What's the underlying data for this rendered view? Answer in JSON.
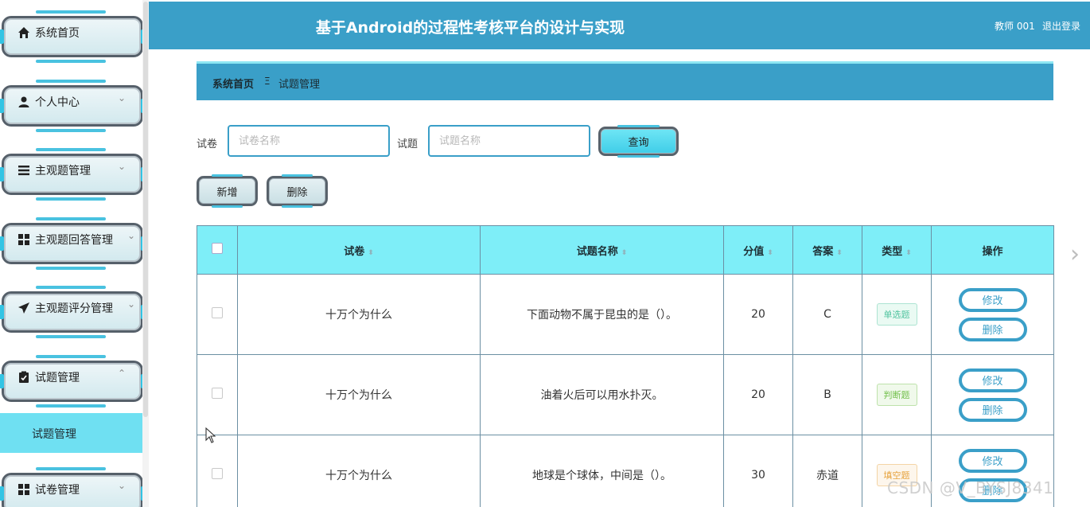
{
  "header": {
    "title": "基于Android的过程性考核平台的设计与实现",
    "user": "教师 001",
    "logout": "退出登录"
  },
  "sidebar": {
    "items": [
      {
        "label": "系统首页",
        "icon": "home-icon"
      },
      {
        "label": "个人中心",
        "icon": "user-icon",
        "chevron": "⌄"
      },
      {
        "label": "主观题管理",
        "icon": "list-icon",
        "chevron": "⌄"
      },
      {
        "label": "主观题回答管理",
        "icon": "grid-icon",
        "chevron": "⌄"
      },
      {
        "label": "主观题评分管理",
        "icon": "paper-plane-icon",
        "chevron": "⌄"
      },
      {
        "label": "试题管理",
        "icon": "clipboard-icon",
        "chevron": "⌃"
      },
      {
        "label": "试卷管理",
        "icon": "grid-icon",
        "chevron": "⌄"
      }
    ],
    "active_submenu": "试题管理"
  },
  "breadcrumb": {
    "home": "系统首页",
    "separator": "Ξ",
    "current": "试题管理"
  },
  "search": {
    "paper_label": "试卷",
    "paper_placeholder": "试卷名称",
    "question_label": "试题",
    "question_placeholder": "试题名称",
    "query_button": "查询"
  },
  "actions": {
    "add": "新增",
    "delete": "删除"
  },
  "table": {
    "headers": {
      "paper": "试卷",
      "question": "试题名称",
      "score": "分值",
      "answer": "答案",
      "type": "类型",
      "ops": "操作"
    },
    "sort_icon": "⬍",
    "edit_label": "修改",
    "delete_label": "删除",
    "rows": [
      {
        "paper": "十万个为什么",
        "question": "下面动物不属于昆虫的是（）。",
        "score": "20",
        "answer": "C",
        "type": "单选题",
        "type_color": "#52c4a0",
        "type_bg": "#eafaf3"
      },
      {
        "paper": "十万个为什么",
        "question": "油着火后可以用水扑灭。",
        "score": "20",
        "answer": "B",
        "type": "判断题",
        "type_color": "#72c04b",
        "type_bg": "#f0f9eb"
      },
      {
        "paper": "十万个为什么",
        "question": "地球是个球体，中间是（）。",
        "score": "30",
        "answer": "赤道",
        "type": "填空题",
        "type_color": "#e6a23c",
        "type_bg": "#fdf6ec"
      }
    ]
  },
  "watermark": "CSDN @V_BYSJ8341",
  "colors": {
    "primary": "#3a9fc8",
    "header_row": "#7eeef8",
    "active_menu": "#6fe0f2"
  }
}
